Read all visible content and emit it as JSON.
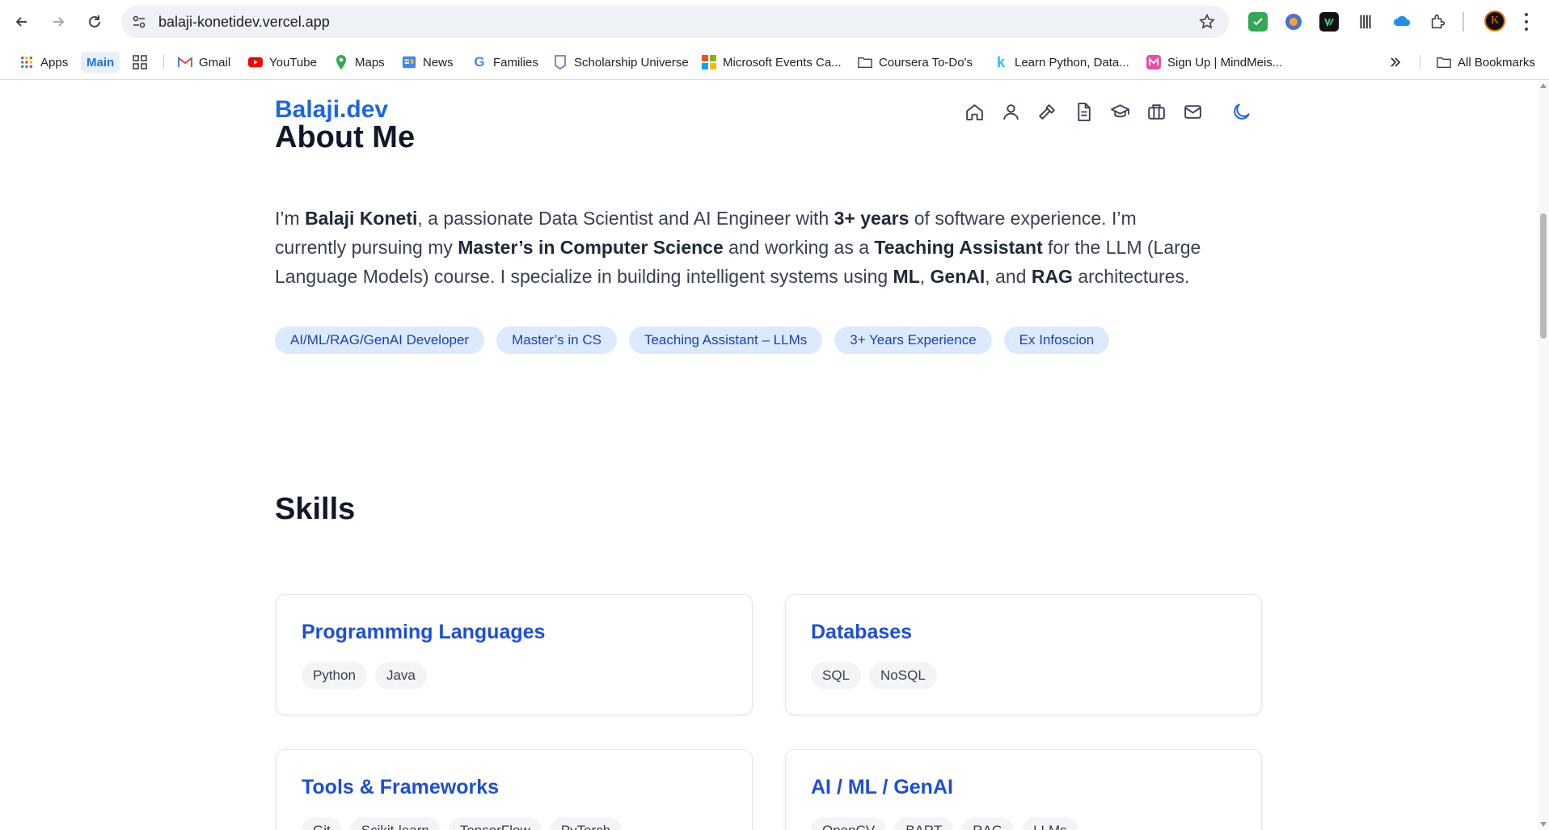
{
  "browser": {
    "url": "balaji-konetidev.vercel.app",
    "profile_initial": "K",
    "bookmarks": [
      {
        "label": "Apps",
        "icon": "apps-grid-icon"
      },
      {
        "label": "Main",
        "icon": ""
      },
      {
        "label": "",
        "icon": "tab-groups-icon"
      },
      {
        "label": "Gmail",
        "icon": "gmail-icon"
      },
      {
        "label": "YouTube",
        "icon": "youtube-icon"
      },
      {
        "label": "Maps",
        "icon": "maps-pin-icon"
      },
      {
        "label": "News",
        "icon": "google-news-icon"
      },
      {
        "label": "Families",
        "icon": "google-g-icon"
      },
      {
        "label": "Scholarship Universe",
        "icon": "scholarship-icon"
      },
      {
        "label": "Microsoft Events Ca...",
        "icon": "microsoft-icon"
      },
      {
        "label": "Coursera To-Do's",
        "icon": "folder-icon"
      },
      {
        "label": "Learn Python, Data...",
        "icon": "kaggle-icon"
      },
      {
        "label": "Sign Up | MindMeis...",
        "icon": "mindmeister-icon"
      }
    ],
    "all_bookmarks_label": "All Bookmarks"
  },
  "site": {
    "brand": "Balaji.dev",
    "nav_icons": [
      "home-icon",
      "user-icon",
      "hammer-icon",
      "document-icon",
      "graduation-cap-icon",
      "briefcase-icon",
      "mail-icon"
    ],
    "theme_icon": "moon-icon"
  },
  "about": {
    "heading": "About Me",
    "p1": "I’m ",
    "name": "Balaji Koneti",
    "p2": ", a passionate Data Scientist and AI Engineer with ",
    "years": "3+ years",
    "p3": " of software experience. I’m currently pursuing my ",
    "masters": "Master’s in Computer Science",
    "p4": " and working as a ",
    "ta": "Teaching Assistant",
    "p5": " for the LLM (Large Language Models) course. I specialize in building intelligent systems using ",
    "ml": "ML",
    "p6": ", ",
    "genai": "GenAI",
    "p7": ", and ",
    "rag": "RAG",
    "p8": " architectures.",
    "tags": [
      "AI/ML/RAG/GenAI Developer",
      "Master’s in CS",
      "Teaching Assistant – LLMs",
      "3+ Years Experience",
      "Ex Infoscion"
    ]
  },
  "skills": {
    "heading": "Skills",
    "cards": [
      {
        "title": "Programming Languages",
        "items": [
          "Python",
          "Java"
        ]
      },
      {
        "title": "Databases",
        "items": [
          "SQL",
          "NoSQL"
        ]
      },
      {
        "title": "Tools & Frameworks",
        "items": [
          "Git",
          "Scikit-learn",
          "TensorFlow",
          "PyTorch"
        ]
      },
      {
        "title": "AI / ML / GenAI",
        "items": [
          "OpenCV",
          "BART",
          "RAG",
          "LLMs"
        ]
      }
    ]
  }
}
